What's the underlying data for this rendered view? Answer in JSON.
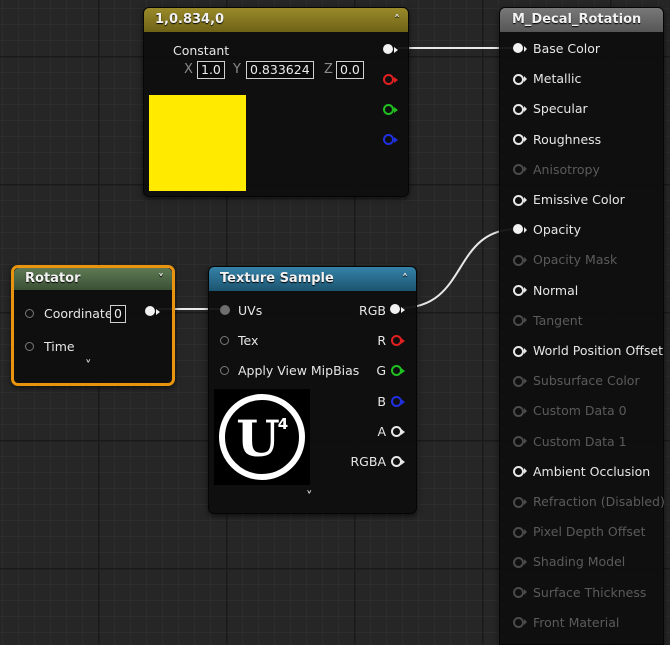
{
  "constant_node": {
    "title": "1,0.834,0",
    "label": "Constant",
    "x_label": "X",
    "x_value": "1.0",
    "y_label": "Y",
    "y_value": "0.833624",
    "z_label": "Z",
    "z_value": "0.0",
    "swatch_color": "#ffea00",
    "header_color": "#8a7a1e"
  },
  "rotator_node": {
    "title": "Rotator",
    "coordinate_label": "Coordinate",
    "coordinate_value": "0",
    "time_label": "Time",
    "header_color": "#4f6a46",
    "selection_color": "#e8940f"
  },
  "texture_node": {
    "title": "Texture Sample",
    "inputs": [
      "UVs",
      "Tex",
      "Apply View MipBias"
    ],
    "outputs": [
      "RGB",
      "R",
      "G",
      "B",
      "A",
      "RGBA"
    ],
    "header_color": "#2b6d8c"
  },
  "material_node": {
    "title": "M_Decal_Rotation",
    "header_color": "#6a6a6a",
    "pins": [
      {
        "label": "Base Color",
        "state": "connected"
      },
      {
        "label": "Metallic",
        "state": "enabled"
      },
      {
        "label": "Specular",
        "state": "enabled"
      },
      {
        "label": "Roughness",
        "state": "enabled"
      },
      {
        "label": "Anisotropy",
        "state": "disabled"
      },
      {
        "label": "Emissive Color",
        "state": "enabled"
      },
      {
        "label": "Opacity",
        "state": "connected"
      },
      {
        "label": "Opacity Mask",
        "state": "disabled"
      },
      {
        "label": "Normal",
        "state": "enabled"
      },
      {
        "label": "Tangent",
        "state": "disabled"
      },
      {
        "label": "World Position Offset",
        "state": "enabled"
      },
      {
        "label": "Subsurface Color",
        "state": "disabled"
      },
      {
        "label": "Custom Data 0",
        "state": "disabled"
      },
      {
        "label": "Custom Data 1",
        "state": "disabled"
      },
      {
        "label": "Ambient Occlusion",
        "state": "enabled"
      },
      {
        "label": "Refraction (Disabled)",
        "state": "disabled"
      },
      {
        "label": "Pixel Depth Offset",
        "state": "disabled"
      },
      {
        "label": "Shading Model",
        "state": "disabled"
      },
      {
        "label": "Surface Thickness",
        "state": "disabled"
      },
      {
        "label": "Front Material",
        "state": "disabled"
      }
    ]
  },
  "ue_logo": {
    "letter": "U",
    "superscript": "4"
  }
}
